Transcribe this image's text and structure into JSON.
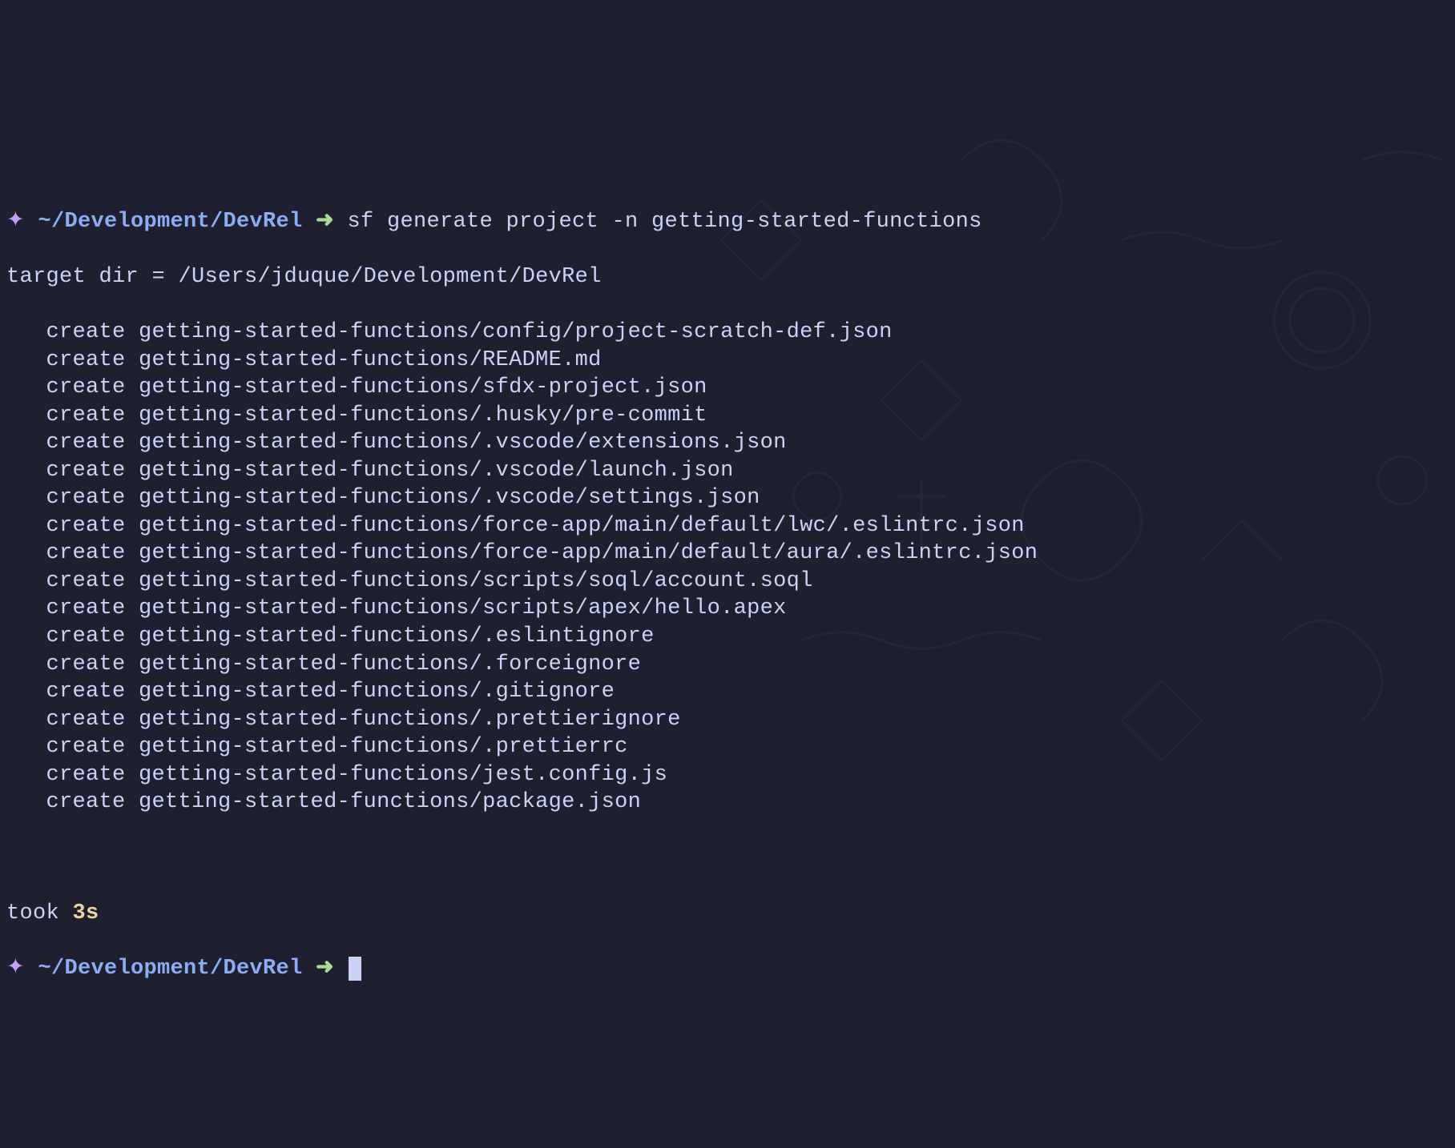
{
  "prompt1": {
    "symbol": "✦",
    "path": "~/Development/DevRel",
    "arrow": "➜",
    "command": "sf generate project -n getting-started-functions"
  },
  "output": {
    "target_dir": "target dir = /Users/jduque/Development/DevRel",
    "lines": [
      "   create getting-started-functions/config/project-scratch-def.json",
      "   create getting-started-functions/README.md",
      "   create getting-started-functions/sfdx-project.json",
      "   create getting-started-functions/.husky/pre-commit",
      "   create getting-started-functions/.vscode/extensions.json",
      "   create getting-started-functions/.vscode/launch.json",
      "   create getting-started-functions/.vscode/settings.json",
      "   create getting-started-functions/force-app/main/default/lwc/.eslintrc.json",
      "   create getting-started-functions/force-app/main/default/aura/.eslintrc.json",
      "   create getting-started-functions/scripts/soql/account.soql",
      "   create getting-started-functions/scripts/apex/hello.apex",
      "   create getting-started-functions/.eslintignore",
      "   create getting-started-functions/.forceignore",
      "   create getting-started-functions/.gitignore",
      "   create getting-started-functions/.prettierignore",
      "   create getting-started-functions/.prettierrc",
      "   create getting-started-functions/jest.config.js",
      "   create getting-started-functions/package.json"
    ]
  },
  "timing": {
    "label": "took ",
    "value": "3s"
  },
  "prompt2": {
    "symbol": "✦",
    "path": "~/Development/DevRel",
    "arrow": "➜"
  }
}
